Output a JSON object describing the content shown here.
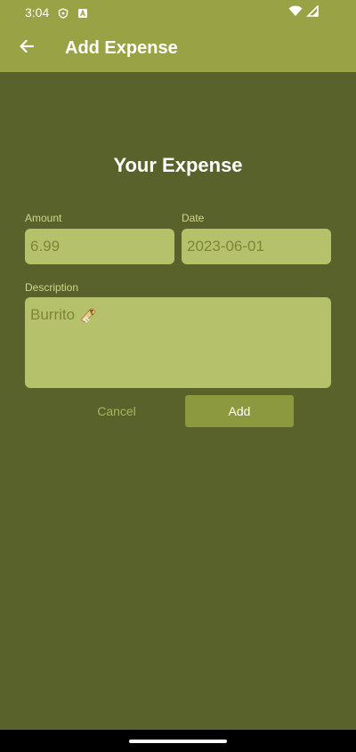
{
  "status_bar": {
    "time": "3:04",
    "icons": [
      "shield-icon",
      "notification-a-icon",
      "wifi-icon",
      "signal-icon"
    ]
  },
  "app_bar": {
    "back_icon": "arrow-left-icon",
    "title": "Add Expense"
  },
  "form": {
    "heading": "Your Expense",
    "amount": {
      "label": "Amount",
      "value": "6.99"
    },
    "date": {
      "label": "Date",
      "value": "2023-06-01"
    },
    "description": {
      "label": "Description",
      "value": "Burrito",
      "emoji": "burrito-icon"
    },
    "cancel_label": "Cancel",
    "add_label": "Add"
  },
  "colors": {
    "app_bar": "#99a245",
    "background": "#5a622c",
    "field": "#b6c26b",
    "field_text": "#7d8638",
    "add_button": "#8c993f"
  }
}
